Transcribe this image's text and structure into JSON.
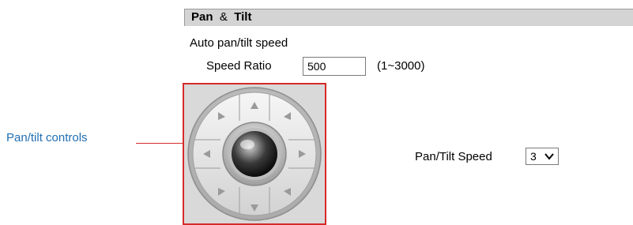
{
  "header": {
    "title_main": "Pan",
    "title_sep": "&",
    "title_end": "Tilt"
  },
  "auto_pan_tilt": {
    "section_label": "Auto pan/tilt speed",
    "speed_ratio_label": "Speed Ratio",
    "speed_ratio_value": "500",
    "speed_ratio_range": "(1~3000)"
  },
  "annotation": {
    "label": "Pan/tilt controls",
    "color": "#d62a2a",
    "label_color": "#1f6fb2"
  },
  "ptz": {
    "icons": {
      "up": "triangle-up-icon",
      "down": "triangle-down-icon",
      "left": "triangle-left-icon",
      "right": "triangle-right-icon",
      "up_left": "triangle-up-left-icon",
      "up_right": "triangle-up-right-icon",
      "down_left": "triangle-down-left-icon",
      "down_right": "triangle-down-right-icon",
      "center": "home-knob-icon"
    }
  },
  "pan_tilt_speed": {
    "label": "Pan/Tilt Speed",
    "value": "3"
  },
  "colors": {
    "header_bg": "#d4d4d4",
    "ptz_bg": "#d9d9d9"
  }
}
